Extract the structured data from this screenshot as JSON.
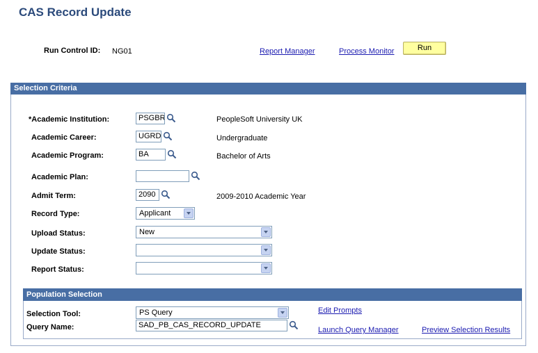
{
  "page": {
    "title": "CAS Record Update"
  },
  "run_control": {
    "label": "Run Control ID:",
    "value": "NG01"
  },
  "links": {
    "report_manager": "Report Manager",
    "process_monitor": "Process Monitor"
  },
  "run_button": {
    "label": "Run"
  },
  "selection_criteria": {
    "header": "Selection Criteria",
    "fields": {
      "institution": {
        "label": "*Academic Institution:",
        "value": "PSGBR",
        "description": "PeopleSoft University UK"
      },
      "career": {
        "label": "Academic Career:",
        "value": "UGRD",
        "description": "Undergraduate"
      },
      "program": {
        "label": "Academic Program:",
        "value": "BA",
        "description": "Bachelor of  Arts"
      },
      "plan": {
        "label": "Academic Plan:",
        "value": ""
      },
      "admit_term": {
        "label": "Admit Term:",
        "value": "2090",
        "description": "2009-2010 Academic Year"
      },
      "record_type": {
        "label": "Record Type:",
        "value": "Applicant"
      },
      "upload_status": {
        "label": "Upload Status:",
        "value": "New"
      },
      "update_status": {
        "label": "Update Status:",
        "value": ""
      },
      "report_status": {
        "label": "Report Status:",
        "value": ""
      }
    }
  },
  "population_selection": {
    "header": "Population Selection",
    "selection_tool": {
      "label": "Selection Tool:",
      "value": "PS Query"
    },
    "query_name": {
      "label": "Query Name:",
      "value": "SAD_PB_CAS_RECORD_UPDATE"
    },
    "links": {
      "edit_prompts": "Edit Prompts",
      "launch_query_manager": "Launch Query Manager",
      "preview_results": "Preview Selection Results"
    }
  },
  "icons": {
    "lookup": "magnifier-icon",
    "dropdown": "chevron-down-icon"
  },
  "colors": {
    "title": "#2b4a7b",
    "header_bg": "#486ea4",
    "link": "#1a1ab0",
    "run_button": "#ffffa0"
  }
}
